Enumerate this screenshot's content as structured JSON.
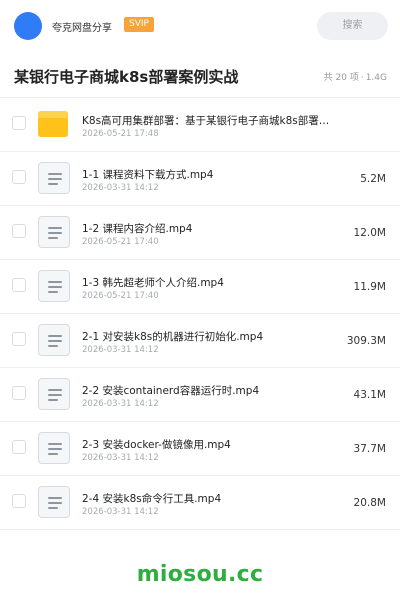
{
  "header": {
    "app_title": "夸克网盘分享",
    "badge": "SVIP",
    "search_label": "搜索"
  },
  "folder": {
    "title": "某银行电子商城k8s部署案例实战",
    "item_count": "共 20 项",
    "total_size": "1.4G"
  },
  "files": [
    {
      "type": "folder",
      "name": "K8s高可用集群部署：基于某银行电子商城k8s部署…",
      "date": "2026-05-21 17:48",
      "size": ""
    },
    {
      "type": "video",
      "name": "1-1 课程资料下载方式.mp4",
      "date": "2026-03-31 14:12",
      "size": "5.2M"
    },
    {
      "type": "video",
      "name": "1-2 课程内容介绍.mp4",
      "date": "2026-05-21 17:40",
      "size": "12.0M"
    },
    {
      "type": "video",
      "name": "1-3 韩先超老师个人介绍.mp4",
      "date": "2026-05-21 17:40",
      "size": "11.9M"
    },
    {
      "type": "video",
      "name": "2-1 对安装k8s的机器进行初始化.mp4",
      "date": "2026-03-31 14:12",
      "size": "309.3M"
    },
    {
      "type": "video",
      "name": "2-2 安装containerd容器运行时.mp4",
      "date": "2026-03-31 14:12",
      "size": "43.1M"
    },
    {
      "type": "video",
      "name": "2-3 安装docker-做镜像用.mp4",
      "date": "2026-03-31 14:12",
      "size": "37.7M"
    },
    {
      "type": "video",
      "name": "2-4 安装k8s命令行工具.mp4",
      "date": "2026-03-31 14:12",
      "size": "20.8M"
    }
  ],
  "watermark": "miosou.cc",
  "colors": {
    "avatar": "#2f7cf6",
    "badge": "#f7a33a",
    "folder_icon": "#ffc21a",
    "watermark": "#2fae3f"
  }
}
